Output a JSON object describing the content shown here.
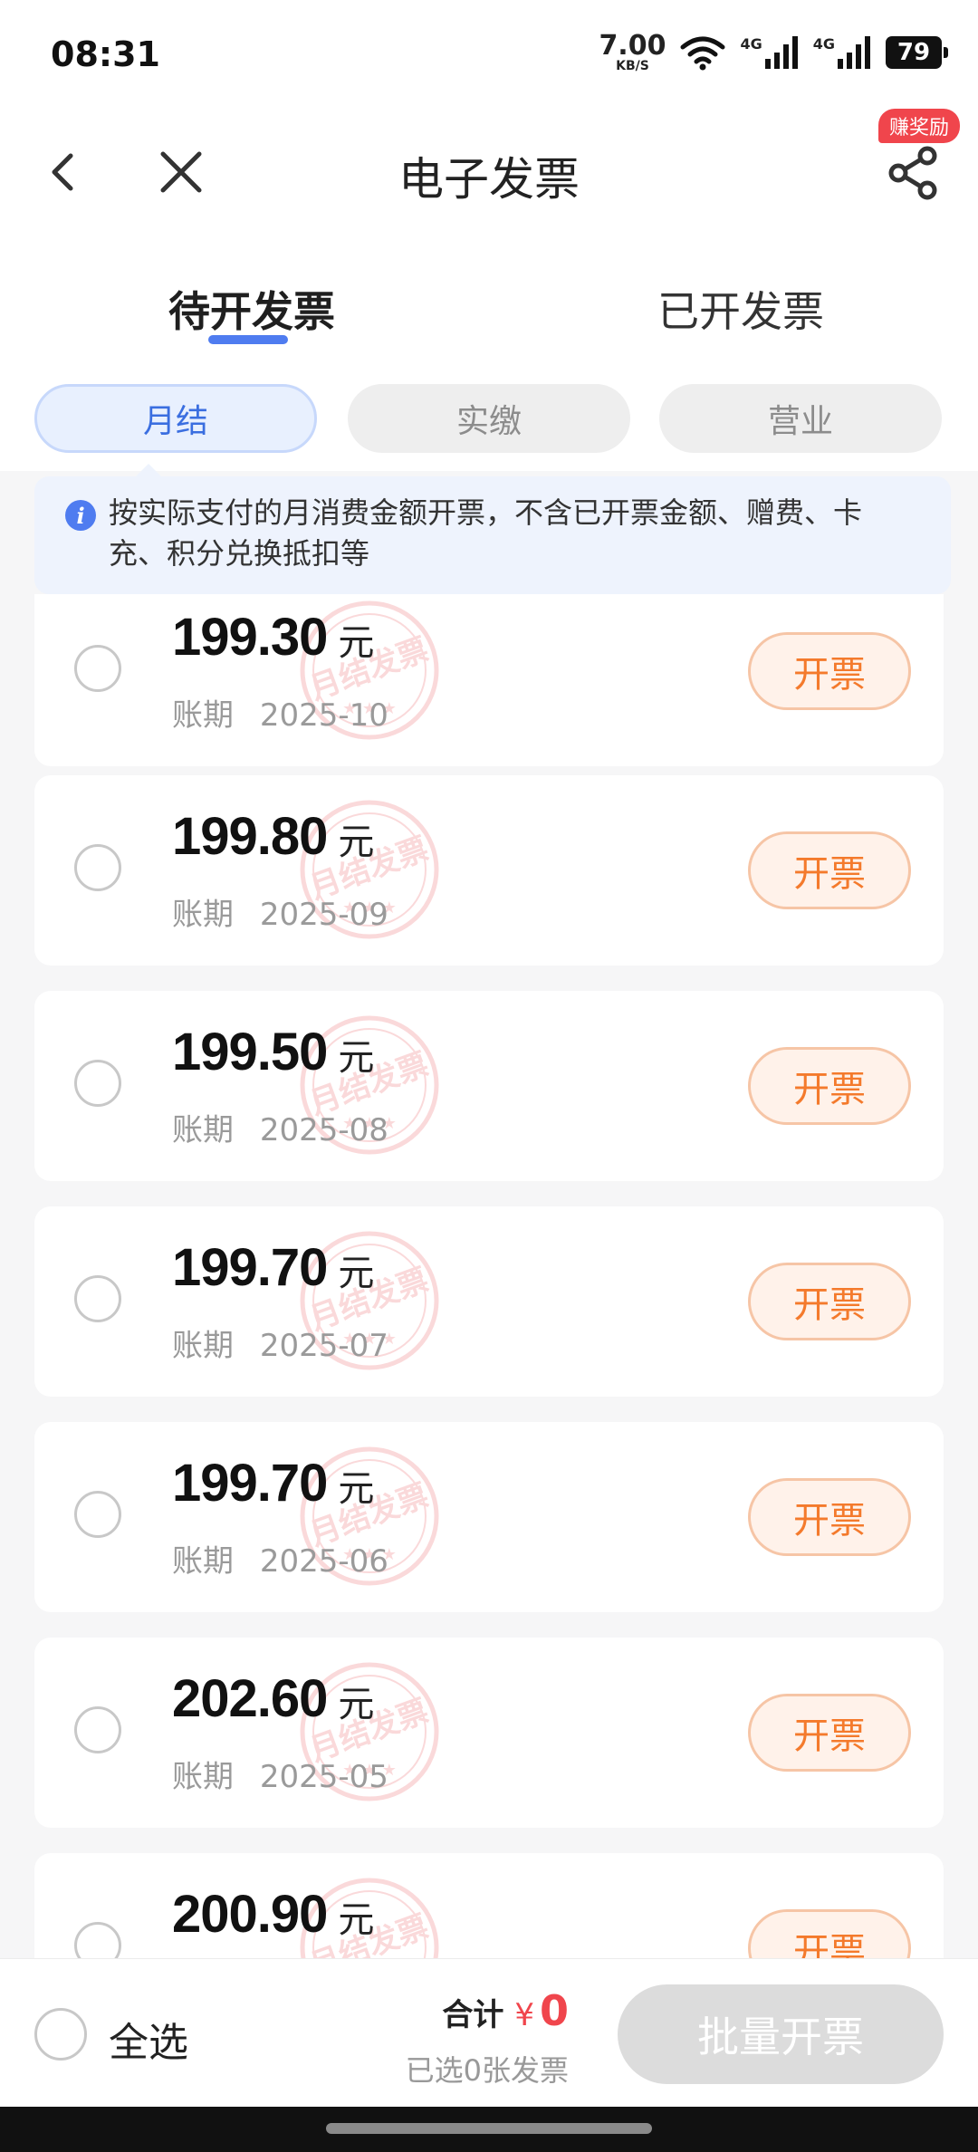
{
  "status_bar": {
    "time": "08:31",
    "net_speed_value": "7.00",
    "net_speed_unit": "KB/S",
    "network_type_1": "4G",
    "network_type_2": "4G",
    "battery": "79"
  },
  "header": {
    "title": "电子发票",
    "reward_badge": "赚奖励",
    "icons": [
      "back-icon",
      "close-icon",
      "share-icon"
    ]
  },
  "tabs": [
    {
      "label": "待开发票",
      "active": true
    },
    {
      "label": "已开发票",
      "active": false
    }
  ],
  "filters": [
    {
      "label": "月结",
      "active": true
    },
    {
      "label": "实缴",
      "active": false
    },
    {
      "label": "营业",
      "active": false
    }
  ],
  "notice": {
    "text": "按实际支付的月消费金额开票，不含已开票金额、赠费、卡充、积分兑换抵扣等"
  },
  "invoice_list": {
    "currency_unit": "元",
    "period_label": "账期",
    "issue_button_label": "开票",
    "stamp_text": "月结发票",
    "items": [
      {
        "amount": "199.30",
        "period": "2025-10"
      },
      {
        "amount": "199.80",
        "period": "2025-09"
      },
      {
        "amount": "199.50",
        "period": "2025-08"
      },
      {
        "amount": "199.70",
        "period": "2025-07"
      },
      {
        "amount": "199.70",
        "period": "2025-06"
      },
      {
        "amount": "202.60",
        "period": "2025-05"
      },
      {
        "amount": "200.90",
        "period": ""
      }
    ]
  },
  "bottom_bar": {
    "select_all_label": "全选",
    "total_label": "合计",
    "currency_symbol": "¥",
    "total_value": "0",
    "selected_count_text": "已选0张发票",
    "batch_button_label": "批量开票"
  },
  "colors": {
    "accent_blue": "#4f7cf0",
    "issue_orange": "#f47a2c",
    "price_red": "#f0454c"
  }
}
